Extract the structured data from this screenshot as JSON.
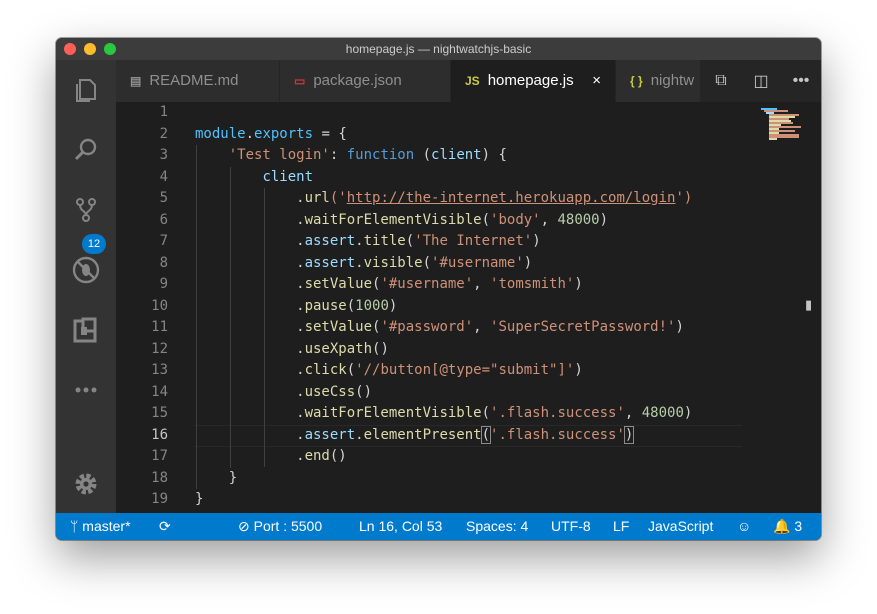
{
  "window": {
    "title": "homepage.js — nightwatchjs-basic"
  },
  "activity_bar": {
    "scm_badge": "12"
  },
  "tabs": [
    {
      "icon": "README-icon",
      "label": "README.md",
      "active": false
    },
    {
      "icon": "npm-icon",
      "label": "package.json",
      "active": false
    },
    {
      "icon": "JS",
      "label": "homepage.js",
      "active": true,
      "close": "×"
    },
    {
      "icon": "{ }",
      "label": "nightw",
      "active": false
    }
  ],
  "editor_actions": [
    "open-changes-icon",
    "split-editor-icon",
    "more-actions-icon"
  ],
  "line_numbers": [
    "1",
    "2",
    "3",
    "4",
    "5",
    "6",
    "7",
    "8",
    "9",
    "10",
    "11",
    "12",
    "13",
    "14",
    "15",
    "16",
    "17",
    "18",
    "19"
  ],
  "current_line": 16,
  "code": {
    "l2a": "module",
    "l2b": ".",
    "l2c": "exports",
    "l2d": " = {",
    "l3a": "    ",
    "l3b": "'Test login'",
    "l3c": ": ",
    "l3d": "function",
    "l3e": " (",
    "l3f": "client",
    "l3g": ") {",
    "l4a": "        ",
    "l4b": "client",
    "l5a": "            .",
    "l5b": "url",
    "l5c": "('",
    "l5d": "http://the-internet.herokuapp.com/login",
    "l5e": "')",
    "l6a": "            .",
    "l6b": "waitForElementVisible",
    "l6c": "(",
    "l6d": "'body'",
    "l6e": ", ",
    "l6f": "48000",
    "l6g": ")",
    "l7a": "            .",
    "l7b": "assert",
    "l7c": ".",
    "l7d": "title",
    "l7e": "(",
    "l7f": "'The Internet'",
    "l7g": ")",
    "l8a": "            .",
    "l8b": "assert",
    "l8c": ".",
    "l8d": "visible",
    "l8e": "(",
    "l8f": "'#username'",
    "l8g": ")",
    "l9a": "            .",
    "l9b": "setValue",
    "l9c": "(",
    "l9d": "'#username'",
    "l9e": ", ",
    "l9f": "'tomsmith'",
    "l9g": ")",
    "l10a": "            .",
    "l10b": "pause",
    "l10c": "(",
    "l10d": "1000",
    "l10e": ")",
    "l11a": "            .",
    "l11b": "setValue",
    "l11c": "(",
    "l11d": "'#password'",
    "l11e": ", ",
    "l11f": "'SuperSecretPassword!'",
    "l11g": ")",
    "l12a": "            .",
    "l12b": "useXpath",
    "l12c": "()",
    "l13a": "            .",
    "l13b": "click",
    "l13c": "(",
    "l13d": "'//button[@type=\"submit\"]'",
    "l13e": ")",
    "l14a": "            .",
    "l14b": "useCss",
    "l14c": "()",
    "l15a": "            .",
    "l15b": "waitForElementVisible",
    "l15c": "(",
    "l15d": "'.flash.success'",
    "l15e": ", ",
    "l15f": "48000",
    "l15g": ")",
    "l16a": "            .",
    "l16b": "assert",
    "l16c": ".",
    "l16d": "elementPresent",
    "l16e": "(",
    "l16f": "'.flash.success'",
    "l16g": ")",
    "l17a": "            .",
    "l17b": "end",
    "l17c": "()",
    "l18a": "    }",
    "l19a": "}"
  },
  "status_bar": {
    "branch": "master*",
    "port": "Port : 5500",
    "position": "Ln 16, Col 53",
    "spaces": "Spaces: 4",
    "encoding": "UTF-8",
    "eol": "LF",
    "language": "JavaScript",
    "notifications": "3"
  },
  "colors": {
    "accent": "#007acc",
    "keyword": "#569cd6",
    "string": "#ce9178",
    "number": "#b5cea8",
    "function": "#dcdcaa"
  }
}
